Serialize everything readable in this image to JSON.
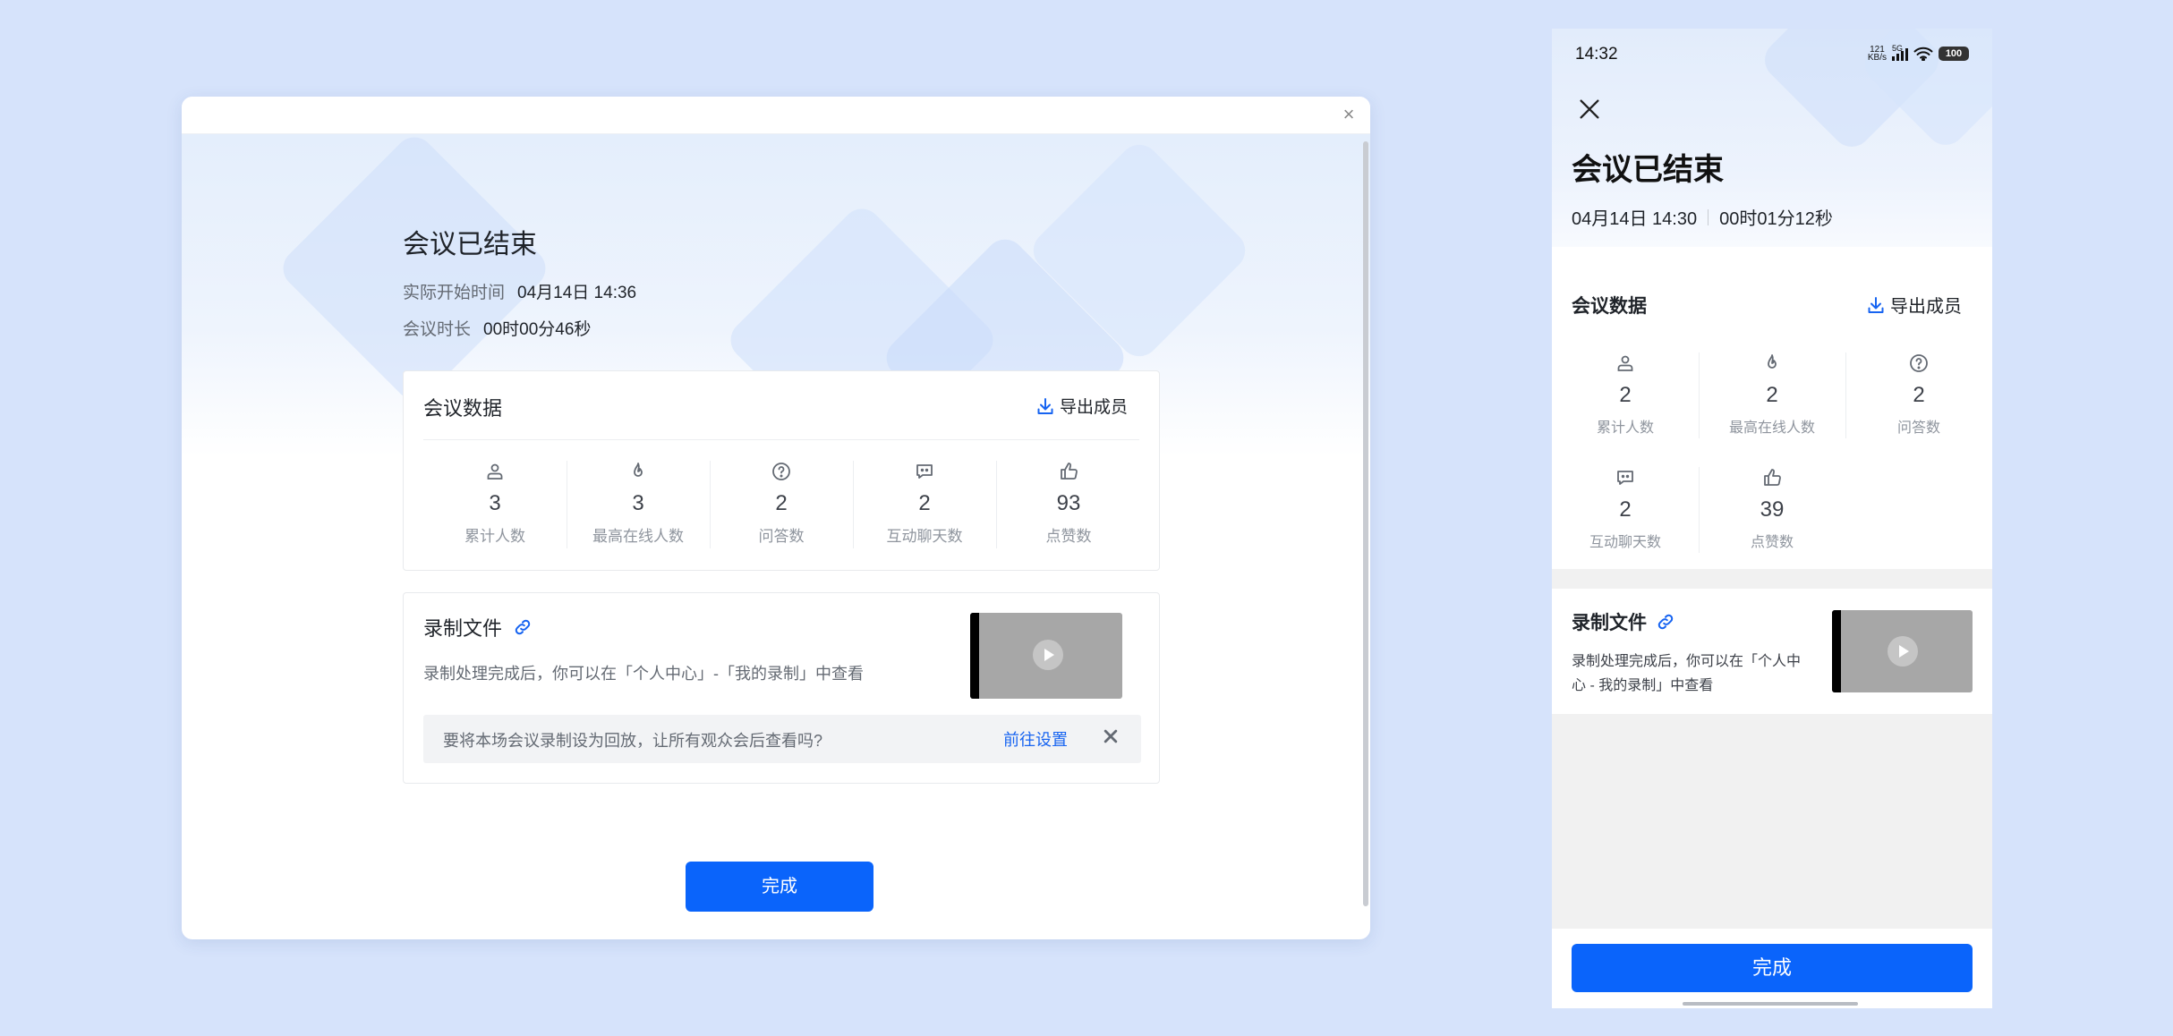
{
  "desktop": {
    "close_glyph": "×",
    "title": "会议已结束",
    "start_label": "实际开始时间",
    "start_value": "04月14日 14:36",
    "duration_label": "会议时长",
    "duration_value": "00时00分46秒",
    "data_card": {
      "title": "会议数据",
      "export_label": "导出成员",
      "stats": [
        {
          "icon": "person-icon",
          "value": "3",
          "label": "累计人数"
        },
        {
          "icon": "fire-icon",
          "value": "3",
          "label": "最高在线人数"
        },
        {
          "icon": "question-icon",
          "value": "2",
          "label": "问答数"
        },
        {
          "icon": "chat-icon",
          "value": "2",
          "label": "互动聊天数"
        },
        {
          "icon": "thumbs-up-icon",
          "value": "93",
          "label": "点赞数"
        }
      ]
    },
    "recording": {
      "title": "录制文件",
      "desc": "录制处理完成后，你可以在「个人中心」-「我的录制」中查看",
      "notice_text": "要将本场会议录制设为回放，让所有观众会后查看吗?",
      "notice_link": "前往设置"
    },
    "done_label": "完成"
  },
  "phone": {
    "time": "14:32",
    "net_speed_top": "121",
    "net_speed_bottom": "KB/s",
    "signal_label": "5G",
    "battery": "100",
    "title": "会议已结束",
    "start_value": "04月14日 14:30",
    "duration_value": "00时01分12秒",
    "data_title": "会议数据",
    "export_label": "导出成员",
    "stats": [
      {
        "icon": "person-icon",
        "value": "2",
        "label": "累计人数"
      },
      {
        "icon": "fire-icon",
        "value": "2",
        "label": "最高在线人数"
      },
      {
        "icon": "question-icon",
        "value": "2",
        "label": "问答数"
      },
      {
        "icon": "chat-icon",
        "value": "2",
        "label": "互动聊天数"
      },
      {
        "icon": "thumbs-up-icon",
        "value": "39",
        "label": "点赞数"
      }
    ],
    "rec_title": "录制文件",
    "rec_desc_line1": "录制处理完成后，你可以在「个人中",
    "rec_desc_line2": "心 - 我的录制」中查看",
    "done_label": "完成"
  },
  "colors": {
    "primary": "#0a64fb",
    "link": "#1764f1",
    "background": "#d6e3fb"
  }
}
